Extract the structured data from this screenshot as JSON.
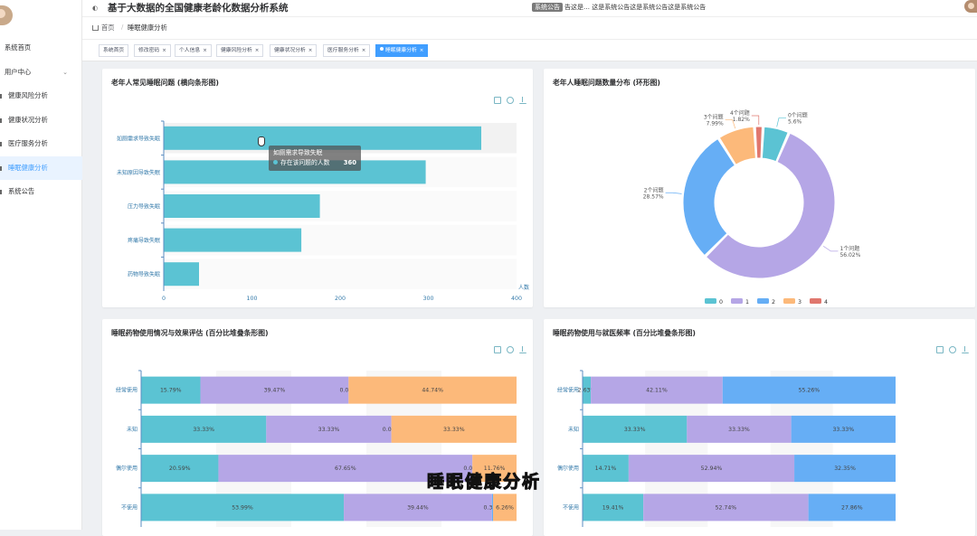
{
  "app": {
    "title": "基于大数据的全国健康老龄化数据分析系统"
  },
  "notice": {
    "badge": "系统公告",
    "text": "告这是… 这是系统公告这是系统公告这是系统公告"
  },
  "sidebar": {
    "items": [
      {
        "label": "系统首页"
      },
      {
        "label": "用户中心"
      },
      {
        "label": "健康风险分析"
      },
      {
        "label": "健康状况分析"
      },
      {
        "label": "医疗服务分析"
      },
      {
        "label": "睡眠健康分析"
      },
      {
        "label": "系统公告"
      }
    ]
  },
  "breadcrumb": {
    "home": "首页",
    "current": "睡眠健康分析"
  },
  "tabs": [
    {
      "label": "系统首页"
    },
    {
      "label": "修改密码"
    },
    {
      "label": "个人信息"
    },
    {
      "label": "健康风险分析"
    },
    {
      "label": "健康状况分析"
    },
    {
      "label": "医疗服务分析"
    },
    {
      "label": "睡眠健康分析"
    }
  ],
  "tooltip": {
    "title": "如厕需求导致失眠",
    "series": "存在该问题的人数",
    "value": "360"
  },
  "caption": "睡眠健康分析",
  "colors": {
    "teal": "#5bc3d3",
    "purple": "#b5a6e6",
    "blue": "#66aef5",
    "orange": "#fcb97a",
    "red": "#e0776e",
    "active": "#409eff"
  },
  "chart_data": [
    {
      "type": "bar",
      "orientation": "horizontal",
      "title": "老年人常见睡眠问题 (横向条形图)",
      "categories": [
        "如厕需求导致失眠",
        "未知原因导致失眠",
        "压力导致失眠",
        "疼痛导致失眠",
        "药物导致失眠"
      ],
      "values": [
        360,
        297,
        177,
        156,
        40
      ],
      "xlim": [
        0,
        400
      ],
      "xticks": [
        "0",
        "100",
        "200",
        "300",
        "400"
      ],
      "xlabel": "人数",
      "highlight_band": "如厕需求导致失眠"
    },
    {
      "type": "pie",
      "variant": "donut",
      "title": "老年人睡眠问题数量分布 (环形图)",
      "slices": [
        {
          "legend": "0",
          "label": "0个问题",
          "pct": "5.6%",
          "value": 5.6
        },
        {
          "legend": "1",
          "label": "1个问题",
          "pct": "56.02%",
          "value": 56.02
        },
        {
          "legend": "2",
          "label": "2个问题",
          "pct": "28.57%",
          "value": 28.57
        },
        {
          "legend": "3",
          "label": "3个问题",
          "pct": "7.99%",
          "value": 7.99
        },
        {
          "legend": "4",
          "label": "4个问题",
          "pct": "1.82%",
          "value": 1.82
        }
      ]
    },
    {
      "type": "bar",
      "stacked": "percent",
      "orientation": "horizontal",
      "title": "睡眠药物使用情况与效果评估 (百分比堆叠条形图)",
      "categories": [
        "经常使用",
        "未知",
        "偶尔使用",
        "不使用"
      ],
      "series": [
        {
          "values": [
            15.79,
            33.33,
            20.59,
            53.99
          ]
        },
        {
          "values": [
            39.47,
            33.33,
            67.65,
            39.44
          ]
        },
        {
          "values": [
            0.0,
            0.0,
            0.0,
            0.31
          ]
        },
        {
          "values": [
            44.74,
            33.33,
            11.76,
            6.26
          ]
        }
      ],
      "labels": [
        [
          "15.79%",
          "39.47%",
          "0.00%",
          "44.74%"
        ],
        [
          "33.33%",
          "33.33%",
          "0.00%",
          "33.33%"
        ],
        [
          "20.59%",
          "67.65%",
          "0.00%",
          "11.76%"
        ],
        [
          "53.99%",
          "39.44%",
          "0.31%",
          "6.26%"
        ]
      ]
    },
    {
      "type": "bar",
      "stacked": "percent",
      "orientation": "horizontal",
      "title": "睡眠药物使用与就医频率 (百分比堆叠条形图)",
      "categories": [
        "经常使用",
        "未知",
        "偶尔使用",
        "不使用"
      ],
      "series": [
        {
          "values": [
            2.63,
            33.33,
            14.71,
            19.41
          ]
        },
        {
          "values": [
            42.11,
            33.33,
            52.94,
            52.74
          ]
        },
        {
          "values": [
            55.26,
            33.33,
            32.35,
            27.86
          ]
        }
      ],
      "labels": [
        [
          "2.63%",
          "42.11%",
          "55.26%"
        ],
        [
          "33.33%",
          "33.33%",
          "33.33%"
        ],
        [
          "14.71%",
          "52.94%",
          "32.35%"
        ],
        [
          "19.41%",
          "52.74%",
          "27.86%"
        ]
      ]
    }
  ]
}
